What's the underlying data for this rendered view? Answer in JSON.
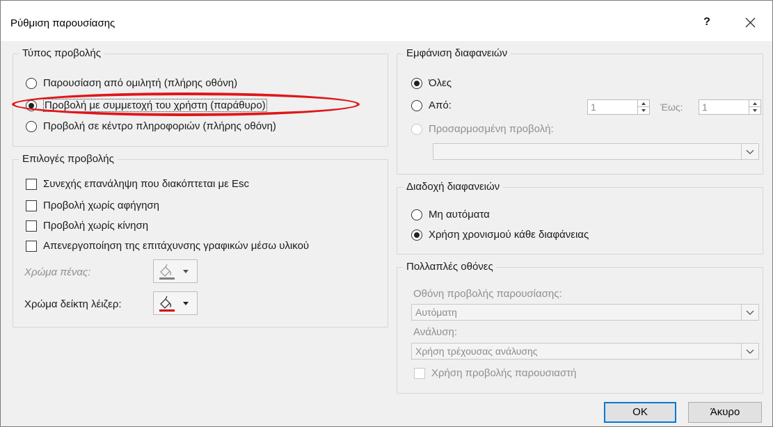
{
  "window": {
    "title": "Ρύθμιση παρουσίασης",
    "help": "?",
    "close_icon": "close-icon"
  },
  "show_type": {
    "legend": "Τύπος προβολής",
    "options": [
      {
        "label": "Παρουσίαση από ομιλητή (πλήρης οθόνη)",
        "checked": false
      },
      {
        "label": "Προβολή με συμμετοχή του χρήστη (παράθυρο)",
        "checked": true
      },
      {
        "label": "Προβολή σε κέντρο πληροφοριών (πλήρης οθόνη)",
        "checked": false
      }
    ]
  },
  "show_options": {
    "legend": "Επιλογές προβολής",
    "checkboxes": [
      {
        "label": "Συνεχής επανάληψη που διακόπτεται με Esc",
        "checked": false
      },
      {
        "label": "Προβολή χωρίς αφήγηση",
        "checked": false
      },
      {
        "label": "Προβολή χωρίς κίνηση",
        "checked": false
      },
      {
        "label": "Απενεργοποίηση της επιτάχυνσης γραφικών μέσω υλικού",
        "checked": false
      }
    ],
    "pen_color_label": "Χρώμα πένας:",
    "pen_color": "#7f7f7f",
    "laser_color_label": "Χρώμα δείκτη λέιζερ:",
    "laser_color": "#d00000"
  },
  "show_slides": {
    "legend": "Εμφάνιση διαφανειών",
    "all_label": "Όλες",
    "from_label": "Από:",
    "from_value": "1",
    "to_label": "Έως:",
    "to_value": "1",
    "custom_label": "Προσαρμοσμένη προβολή:",
    "custom_value": ""
  },
  "advance_slides": {
    "legend": "Διαδοχή διαφανειών",
    "manual_label": "Μη αυτόματα",
    "timings_label": "Χρήση χρονισμού κάθε διαφάνειας",
    "selected": "timings"
  },
  "monitors": {
    "legend": "Πολλαπλές οθόνες",
    "monitor_label": "Οθόνη προβολής παρουσίασης:",
    "monitor_value": "Αυτόματη",
    "resolution_label": "Ανάλυση:",
    "resolution_value": "Χρήση τρέχουσας ανάλυσης",
    "presenter_view_label": "Χρήση προβολής παρουσιαστή"
  },
  "buttons": {
    "ok": "OK",
    "cancel": "Άκυρο"
  },
  "annotation": {
    "color": "#e0161a"
  }
}
